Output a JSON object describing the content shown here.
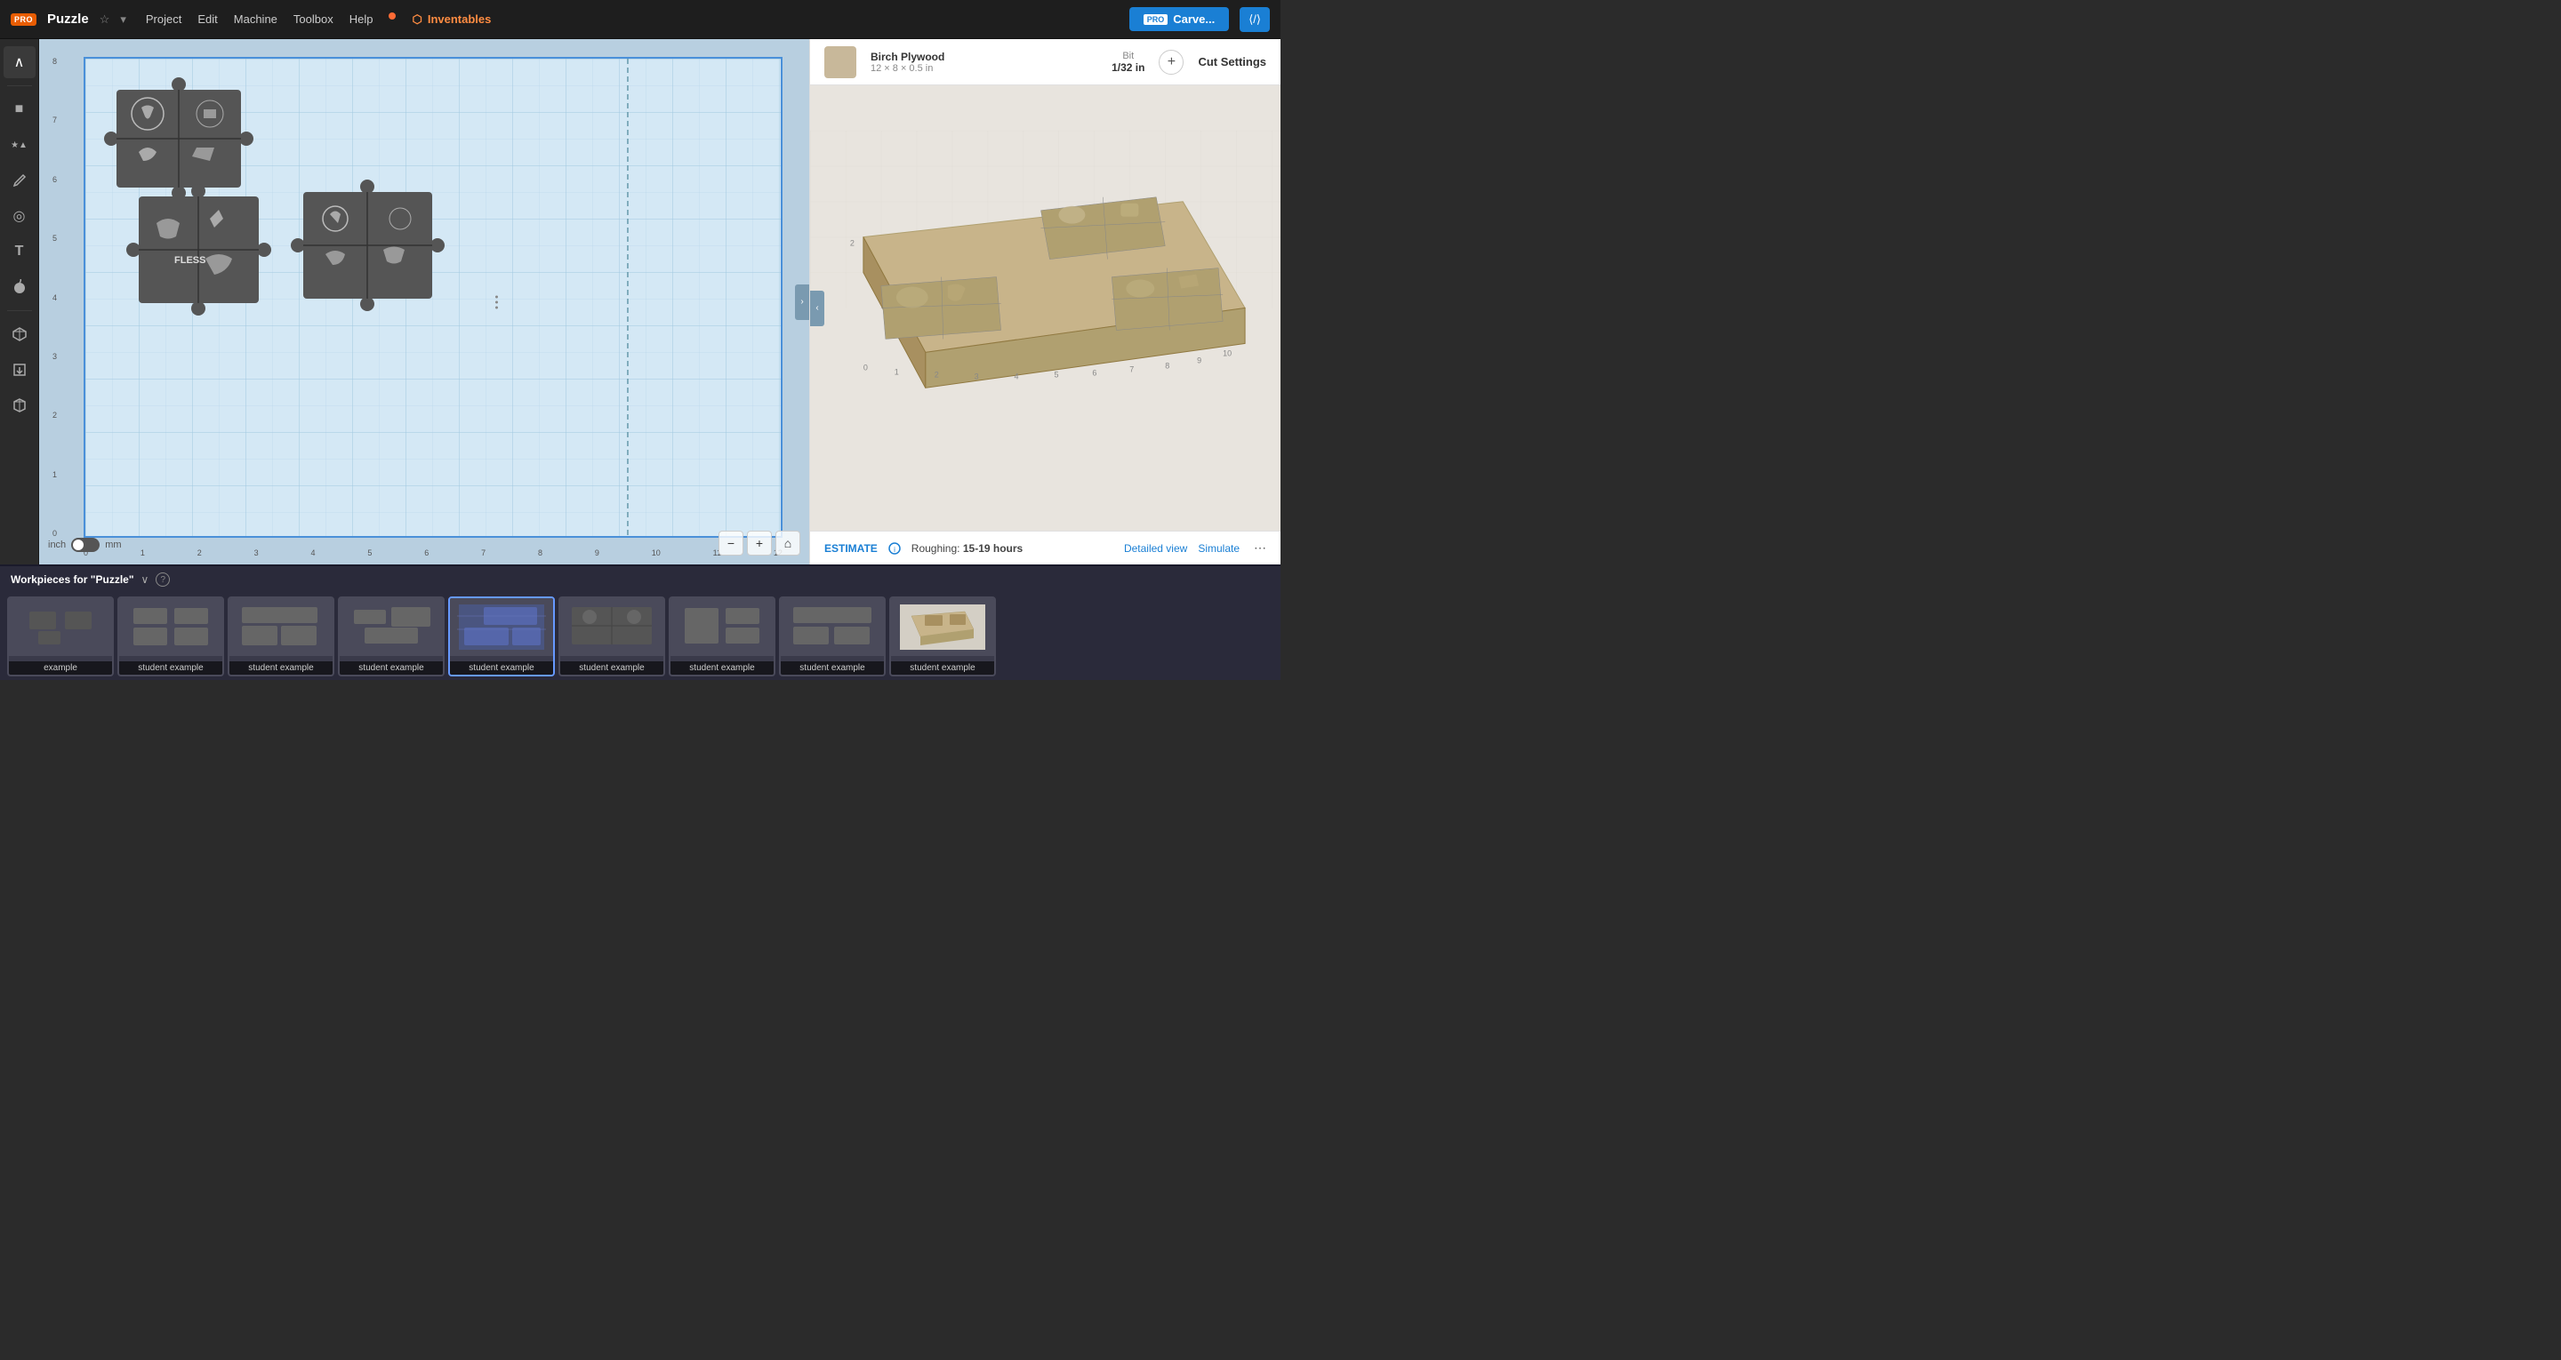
{
  "app": {
    "title": "Puzzle",
    "pro_badge": "PRO",
    "star": "☆",
    "chevron": "▾"
  },
  "nav": {
    "items": [
      "Project",
      "Edit",
      "Machine",
      "Toolbox",
      "Help"
    ],
    "brand": "Inventables",
    "carve_btn": "Carve...",
    "pro_label": "PRO",
    "embed_icon": "⟨/⟩"
  },
  "tools": [
    {
      "name": "collapse-tool",
      "icon": "∧",
      "label": "Collapse"
    },
    {
      "name": "shape-tool",
      "icon": "■",
      "label": "Shapes"
    },
    {
      "name": "star-shape-tool",
      "icon": "★",
      "label": "Star"
    },
    {
      "name": "triangle-tool",
      "icon": "▲",
      "label": "Triangle"
    },
    {
      "name": "pen-tool",
      "icon": "✏",
      "label": "Pen"
    },
    {
      "name": "circle-tool",
      "icon": "◎",
      "label": "Circle"
    },
    {
      "name": "text-tool",
      "icon": "T",
      "label": "Text"
    },
    {
      "name": "apple-tool",
      "icon": "🍎",
      "label": "Apps"
    },
    {
      "name": "3d-tool",
      "icon": "◈",
      "label": "3D"
    },
    {
      "name": "import-tool",
      "icon": "⬒",
      "label": "Import"
    },
    {
      "name": "cube-tool",
      "icon": "⬡",
      "label": "Cube"
    }
  ],
  "canvas": {
    "unit_inch": "inch",
    "unit_mm": "mm",
    "y_labels": [
      "8",
      "7",
      "6",
      "5",
      "4",
      "3",
      "2",
      "1",
      "0"
    ],
    "x_labels": [
      "0",
      "1",
      "2",
      "3",
      "4",
      "5",
      "6",
      "7",
      "8",
      "9",
      "10",
      "11",
      "12"
    ]
  },
  "material": {
    "name": "Birch Plywood",
    "dims": "12 × 8 × 0.5 in",
    "bit_label": "Bit",
    "bit_value": "1/32 in",
    "cut_settings_label": "Cut Settings"
  },
  "estimate": {
    "label": "ESTIMATE",
    "info": "Roughing:",
    "time": "15-19 hours",
    "detailed_view": "Detailed view",
    "simulate": "Simulate"
  },
  "workpieces": {
    "title": "Workpieces for \"Puzzle\"",
    "chevron": "∨",
    "items": [
      {
        "label": "example",
        "active": false
      },
      {
        "label": "student example",
        "active": false
      },
      {
        "label": "student example",
        "active": false
      },
      {
        "label": "student example",
        "active": false
      },
      {
        "label": "student example",
        "active": true
      },
      {
        "label": "student example",
        "active": false
      },
      {
        "label": "student example",
        "active": false
      },
      {
        "label": "student example",
        "active": false
      },
      {
        "label": "student example",
        "active": false
      }
    ]
  },
  "colors": {
    "accent_blue": "#1a7fd4",
    "nav_bg": "#1e1e1e",
    "canvas_bg": "#d4e8f5",
    "canvas_border": "#4a90d9",
    "toolbar_bg": "#2b2b2b",
    "strip_bg": "#2a2a3a",
    "active_workpiece": "#6699ff"
  }
}
